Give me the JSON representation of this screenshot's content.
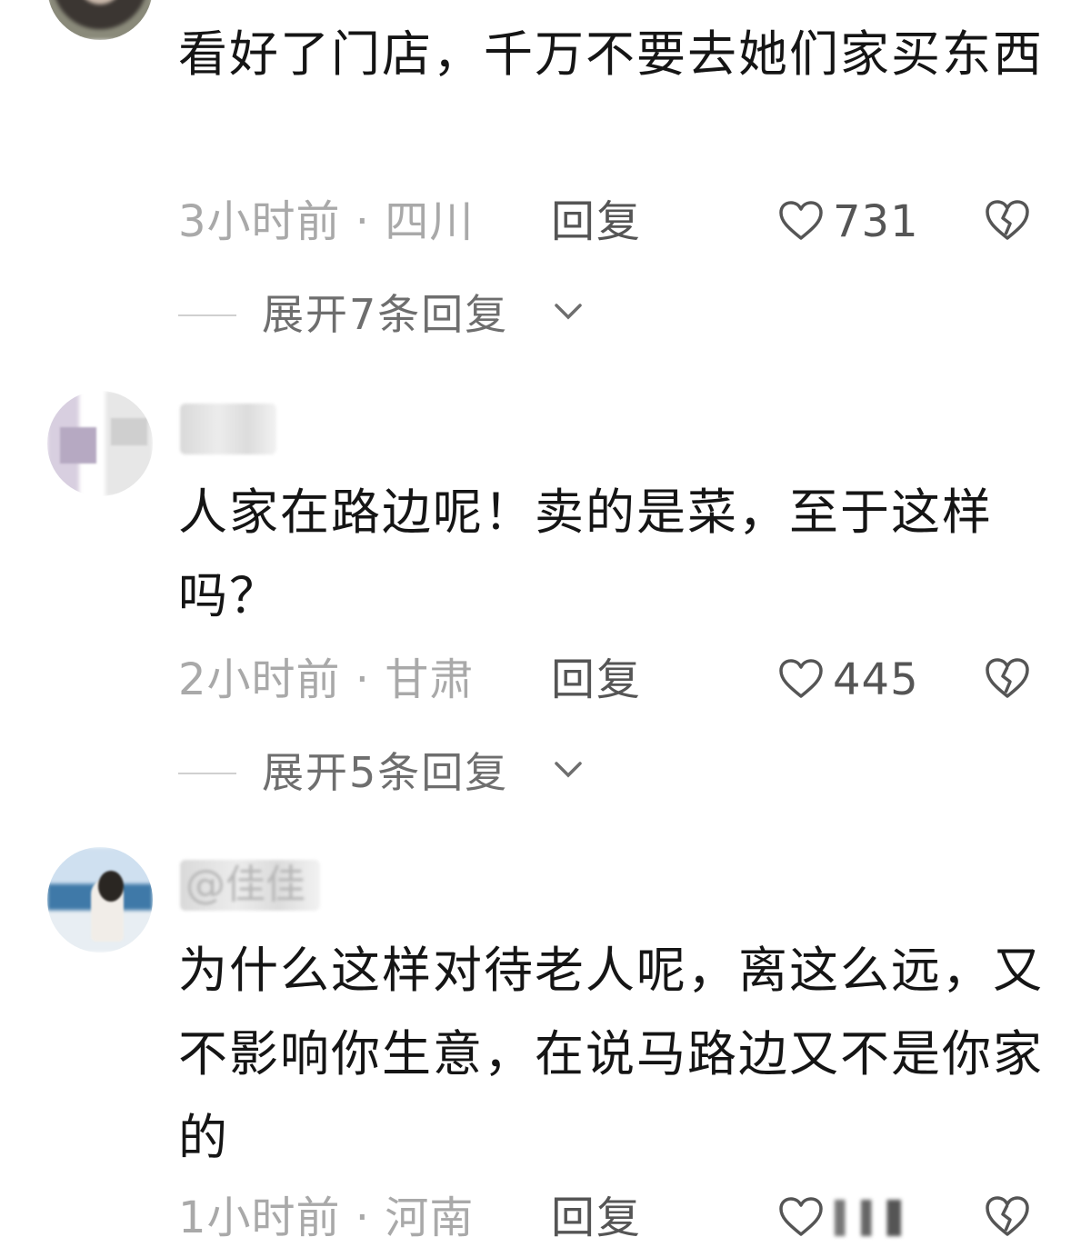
{
  "comments": [
    {
      "username": "",
      "text": "看好了门店，千万不要去她们家买东西",
      "time_location": "3小时前 · 四川",
      "reply_label": "回复",
      "likes": "731",
      "expand_label": "展开7条回复"
    },
    {
      "username": "",
      "text": "人家在路边呢！卖的是菜，至于这样吗？",
      "time_location": "2小时前 · 甘肃",
      "reply_label": "回复",
      "likes": "445",
      "expand_label": "展开5条回复"
    },
    {
      "username": "@佳佳",
      "text": "为什么这样对待老人呢，离这么远，又不影响你生意，在说马路边又不是你家的",
      "time_location": "1小时前 · 河南",
      "reply_label": "回复",
      "likes": ""
    }
  ],
  "icons": {
    "like": "heart-outline-icon",
    "dislike": "broken-heart-icon",
    "expand": "chevron-down-icon"
  },
  "colors": {
    "text": "#151515",
    "meta": "#a9a9a9",
    "action": "#555555"
  }
}
